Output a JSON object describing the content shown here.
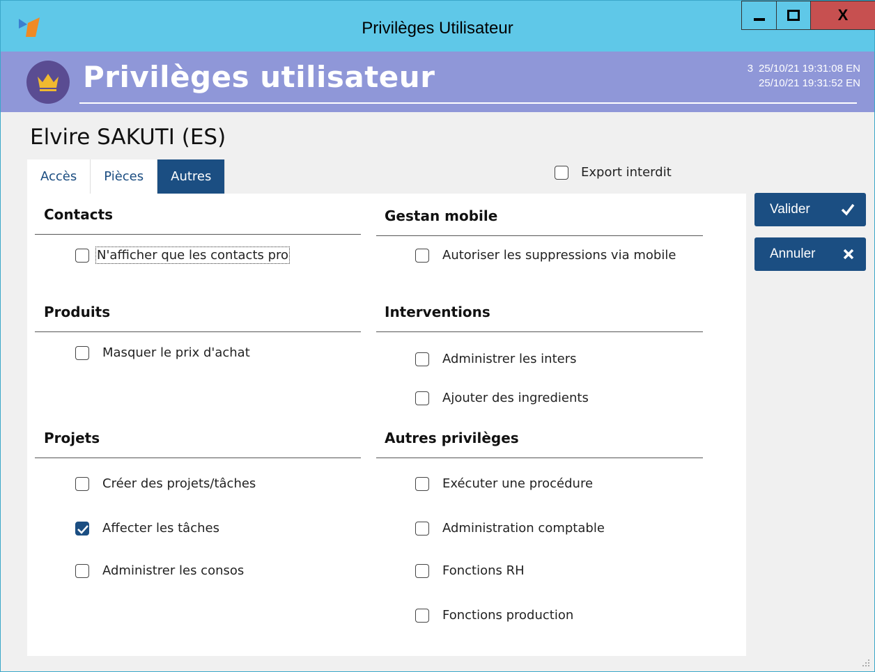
{
  "window": {
    "title": "Privilèges Utilisateur",
    "close_label": "X"
  },
  "header": {
    "title": "Privilèges utilisateur",
    "meta_number": "3",
    "created": "25/10/21 19:31:08",
    "created_user": "EN",
    "modified": "25/10/21 19:31:52",
    "modified_user": "EN",
    "band_color": "#8f97d8"
  },
  "user": {
    "name": "Elvire SAKUTI (ES)"
  },
  "tabs": [
    {
      "label": "Accès"
    },
    {
      "label": "Pièces"
    },
    {
      "label": "Autres",
      "active": true
    }
  ],
  "export": {
    "label": "Export interdit",
    "checked": false
  },
  "sections": {
    "contacts": {
      "title": "Contacts",
      "options": [
        {
          "label": "N'afficher que les contacts pro",
          "checked": false
        }
      ]
    },
    "produits": {
      "title": "Produits",
      "options": [
        {
          "label": "Masquer le prix d'achat",
          "checked": false
        }
      ]
    },
    "projets": {
      "title": "Projets",
      "options": [
        {
          "label": "Créer des projets/tâches",
          "checked": false
        },
        {
          "label": "Affecter les tâches",
          "checked": true
        },
        {
          "label": "Administrer les consos",
          "checked": false
        }
      ]
    },
    "gestan_mobile": {
      "title": "Gestan mobile",
      "options": [
        {
          "label": "Autoriser les suppressions via mobile",
          "checked": false
        }
      ]
    },
    "interventions": {
      "title": "Interventions",
      "options": [
        {
          "label": "Administrer les inters",
          "checked": false
        },
        {
          "label": "Ajouter des ingredients",
          "checked": false
        }
      ]
    },
    "autres": {
      "title": "Autres privilèges",
      "options": [
        {
          "label": "Exécuter une procédure",
          "checked": false
        },
        {
          "label": "Administration comptable",
          "checked": false
        },
        {
          "label": "Fonctions RH",
          "checked": false
        },
        {
          "label": "Fonctions production",
          "checked": false
        }
      ]
    }
  },
  "buttons": {
    "validate_label": "Valider",
    "cancel_label": "Annuler",
    "accent_color": "#1b4e82"
  }
}
